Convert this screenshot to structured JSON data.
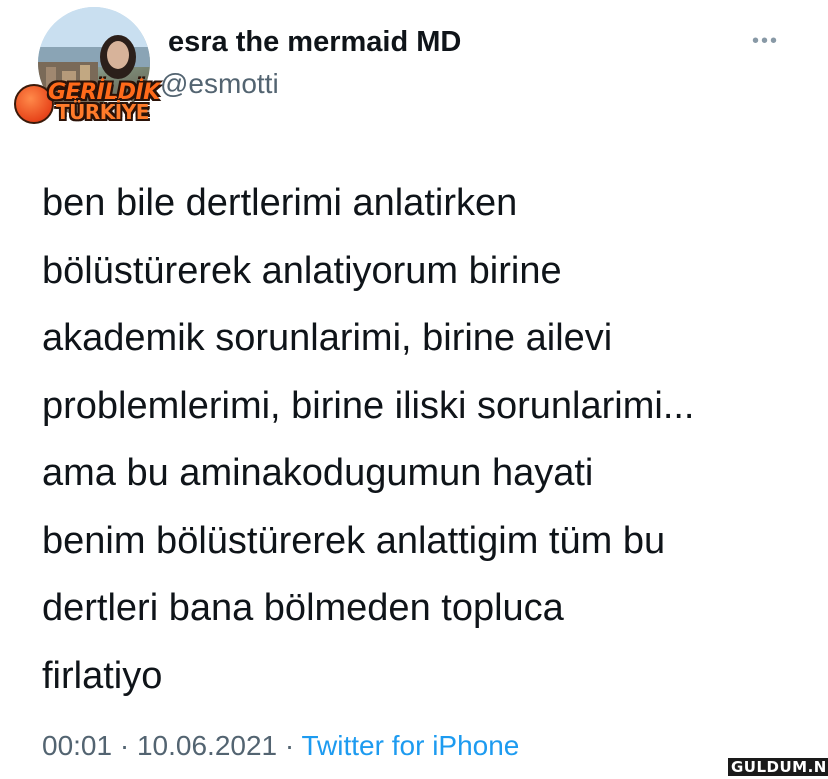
{
  "author": {
    "display_name": "esra the mermaid MD",
    "handle": "@esmotti",
    "badge": [
      "GERİLDİK",
      "TÜRKİYE"
    ]
  },
  "tweet": {
    "text": "ben bile dertlerimi anlatirken\nbölüstürerek anlatiyorum birine\nakademik sorunlarimi, birine ailevi\nproblemlerimi, birine iliski sorunlarimi...\nama bu aminakodugumun hayati\nbenim bölüstürerek anlattigim tüm bu\ndertleri bana bölmeden topluca\nfirlatiyo",
    "time": "00:01",
    "separator": "·",
    "date": "10.06.2021",
    "source": "Twitter for iPhone"
  },
  "menu": {
    "more_label": "•••"
  },
  "watermark": "GULDUM.NET",
  "colors": {
    "text": "#0f1419",
    "muted": "#536471",
    "link": "#1d9bf0",
    "badge": "#ff6a1a"
  },
  "icons": {
    "more": "more-dots-icon",
    "badge": "angry-face-icon"
  }
}
